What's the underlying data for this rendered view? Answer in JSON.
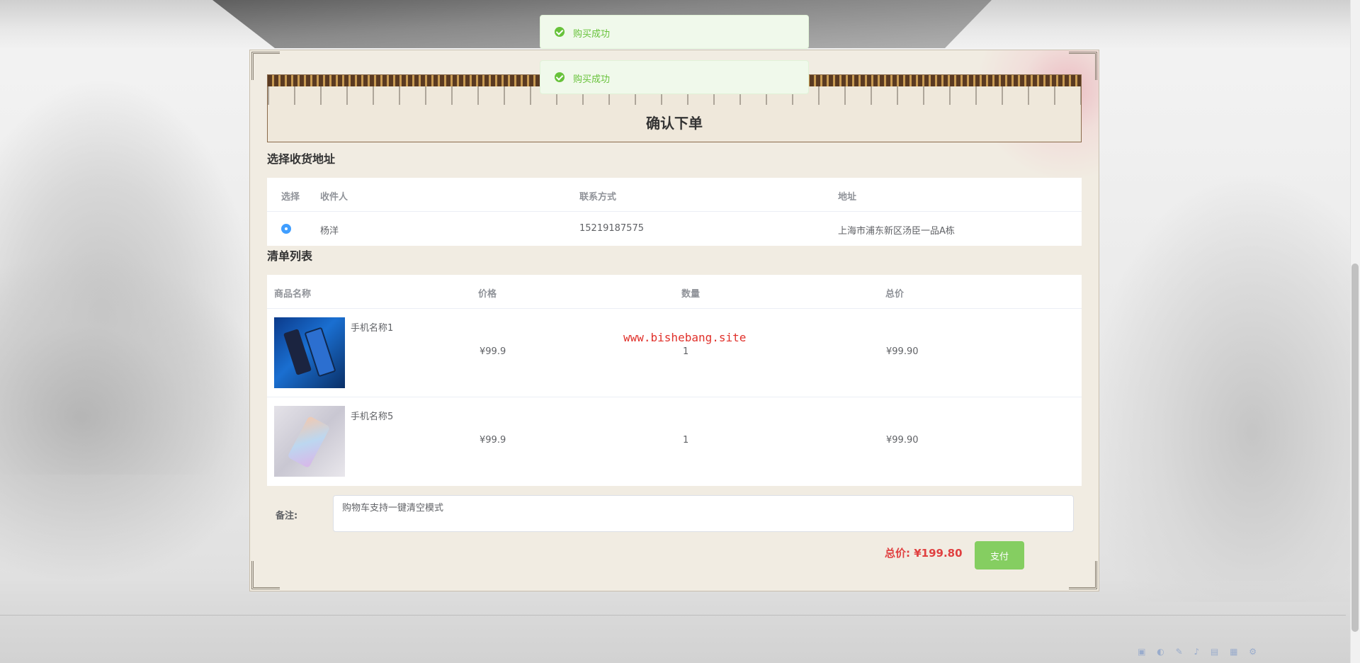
{
  "toasts": [
    {
      "message": "购买成功"
    },
    {
      "message": "购买成功"
    }
  ],
  "page": {
    "title": "确认下单",
    "address_section_title": "选择收货地址",
    "list_section_title": "清单列表"
  },
  "address_table": {
    "headers": {
      "select": "选择",
      "receiver": "收件人",
      "contact": "联系方式",
      "address": "地址"
    },
    "rows": [
      {
        "receiver": "杨洋",
        "contact": "15219187575",
        "address": "上海市浦东新区汤臣一品A栋",
        "selected": true
      }
    ]
  },
  "goods_table": {
    "headers": {
      "name": "商品名称",
      "price": "价格",
      "quantity": "数量",
      "total": "总价"
    },
    "rows": [
      {
        "name": "手机名称1",
        "price": "¥99.9",
        "quantity": "1",
        "total": "¥99.90"
      },
      {
        "name": "手机名称5",
        "price": "¥99.9",
        "quantity": "1",
        "total": "¥99.90"
      }
    ]
  },
  "watermark": "www.bishebang.site",
  "remark": {
    "label": "备注:",
    "value": "购物车支持一键清空模式"
  },
  "summary": {
    "total_label": "总价: ¥199.80",
    "pay_label": "支付"
  },
  "colors": {
    "success": "#67c23a",
    "primary": "#409eff",
    "danger": "#e04040",
    "pay_button": "#85ce61"
  }
}
